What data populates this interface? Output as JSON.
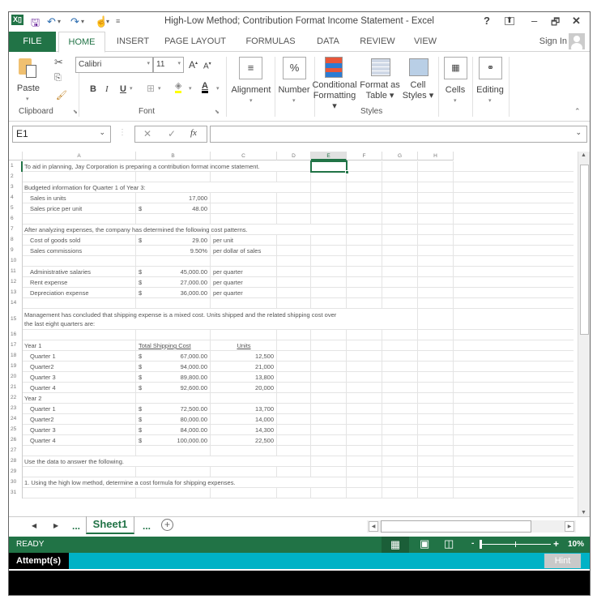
{
  "titlebar": {
    "title": "High-Low Method; Contribution Format Income Statement - Excel",
    "help": "?",
    "minimize": "–",
    "restore": "🗗",
    "close": "✕"
  },
  "tabs": [
    "FILE",
    "HOME",
    "INSERT",
    "PAGE LAYOUT",
    "FORMULAS",
    "DATA",
    "REVIEW",
    "VIEW"
  ],
  "sign_in": "Sign In",
  "ribbon": {
    "paste": "Paste",
    "clipboard": "Clipboard",
    "font_name": "Calibri",
    "font_size": "11",
    "font_group": "Font",
    "bold": "B",
    "italic": "I",
    "underline": "U",
    "alignment": "Alignment",
    "number": "Number",
    "number_icon": "%",
    "conditional_formatting": [
      "Conditional",
      "Formatting"
    ],
    "format_as_table": [
      "Format as",
      "Table"
    ],
    "cell_styles": [
      "Cell",
      "Styles"
    ],
    "styles_group": "Styles",
    "cells": "Cells",
    "editing": "Editing"
  },
  "formula_bar": {
    "name_box": "E1",
    "fx": "fx",
    "value": ""
  },
  "columns": [
    "A",
    "B",
    "C",
    "D",
    "E",
    "F",
    "G",
    "H"
  ],
  "rows": [
    {
      "n": "1",
      "a": "To aid in planning, Jay Corporation is preparing a contribution format income statement."
    },
    {
      "n": "2"
    },
    {
      "n": "3",
      "a": "Budgeted information for Quarter 1 of Year 3:"
    },
    {
      "n": "4",
      "a": "Sales in units",
      "indent": true,
      "b": "17,000"
    },
    {
      "n": "5",
      "a": "Sales price per unit",
      "indent": true,
      "b_cur": "$",
      "b": "48.00"
    },
    {
      "n": "6"
    },
    {
      "n": "7",
      "a": "After analyzing expenses, the company has determined the following cost patterns."
    },
    {
      "n": "8",
      "a": "Cost of goods sold",
      "indent": true,
      "b_cur": "$",
      "b": "29.00",
      "c": "per unit"
    },
    {
      "n": "9",
      "a": "Sales commissions",
      "indent": true,
      "b": "9.50%",
      "c": "per dollar of sales"
    },
    {
      "n": "10"
    },
    {
      "n": "11",
      "a": "Administrative salaries",
      "indent": true,
      "b_cur": "$",
      "b": "45,000.00",
      "c": "per quarter"
    },
    {
      "n": "12",
      "a": "Rent expense",
      "indent": true,
      "b_cur": "$",
      "b": "27,000.00",
      "c": "per quarter"
    },
    {
      "n": "13",
      "a": "Depreciation expense",
      "indent": true,
      "b_cur": "$",
      "b": "36,000.00",
      "c": "per quarter"
    },
    {
      "n": "14"
    },
    {
      "n": "15",
      "a": "Management has concluded that shipping expense is a mixed cost. Units shipped and the related shipping cost over",
      "a2": "the last eight quarters are:",
      "tall": true
    },
    {
      "n": "16"
    },
    {
      "n": "17",
      "a": "Year 1",
      "b_hdr": "Total Shipping Cost",
      "c_hdr": "Units"
    },
    {
      "n": "18",
      "a": "Quarter 1",
      "indent": true,
      "b_cur": "$",
      "b": "67,000.00",
      "c_num": "12,500"
    },
    {
      "n": "19",
      "a": "Quarter2",
      "indent": true,
      "b_cur": "$",
      "b": "94,000.00",
      "c_num": "21,000"
    },
    {
      "n": "20",
      "a": "Quarter 3",
      "indent": true,
      "b_cur": "$",
      "b": "89,800.00",
      "c_num": "13,800"
    },
    {
      "n": "21",
      "a": "Quarter 4",
      "indent": true,
      "b_cur": "$",
      "b": "92,600.00",
      "c_num": "20,000"
    },
    {
      "n": "22",
      "a": "Year 2"
    },
    {
      "n": "23",
      "a": "Quarter 1",
      "indent": true,
      "b_cur": "$",
      "b": "72,500.00",
      "c_num": "13,700"
    },
    {
      "n": "24",
      "a": "Quarter2",
      "indent": true,
      "b_cur": "$",
      "b": "80,000.00",
      "c_num": "14,000"
    },
    {
      "n": "25",
      "a": "Quarter 3",
      "indent": true,
      "b_cur": "$",
      "b": "84,000.00",
      "c_num": "14,300"
    },
    {
      "n": "26",
      "a": "Quarter 4",
      "indent": true,
      "b_cur": "$",
      "b": "100,000.00",
      "c_num": "22,500"
    },
    {
      "n": "27"
    },
    {
      "n": "28",
      "a": "Use the data to answer the following."
    },
    {
      "n": "29"
    },
    {
      "n": "30",
      "a": "1. Using the high low method, determine a cost formula for shipping expenses."
    },
    {
      "n": "31"
    }
  ],
  "sheet_tabs": {
    "prev": "◀",
    "next": "▶",
    "more_left": "...",
    "active": "Sheet1",
    "more_right": "...",
    "add": "+"
  },
  "status_bar": {
    "state": "READY",
    "zoom": "10%",
    "zoom_minus": "-",
    "zoom_plus": "+"
  },
  "attempt_bar": {
    "label": "Attempt(s)",
    "hint": "Hint"
  },
  "colors": {
    "excel_green": "#217346",
    "attempt_bar": "#00b2c6",
    "hint_button": "#c9c9c9"
  }
}
